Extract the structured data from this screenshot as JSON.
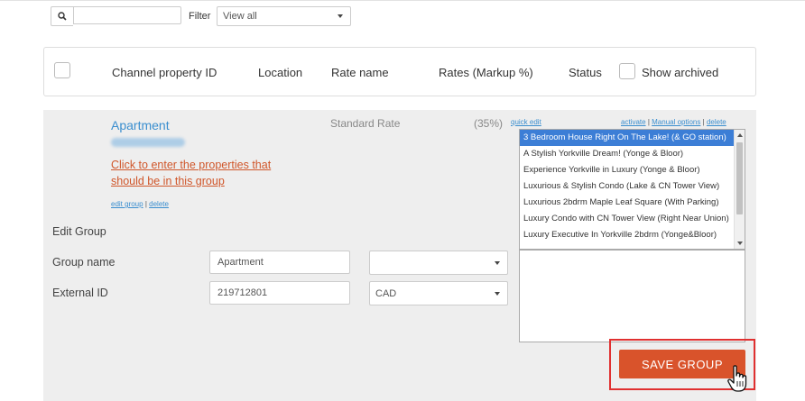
{
  "toolbar": {
    "search_value": "",
    "filter_label": "Filter",
    "filter_value": "View all"
  },
  "header": {
    "col_channel_property_id": "Channel property ID",
    "col_location": "Location",
    "col_rate_name": "Rate name",
    "col_rates_markup": "Rates (Markup %)",
    "col_status": "Status",
    "show_archived_label": "Show archived"
  },
  "group": {
    "title": "Apartment",
    "enter_properties_link": "Click to enter the properties that should be in this group",
    "edit_group_link": "edit group",
    "delete_link": "delete",
    "rate_name": "Standard Rate",
    "markup": "(35%)",
    "quick_edit_link": "quick edit",
    "activate_link": "activate",
    "manual_options_link": "Manual options",
    "delete_link_right": "delete",
    "separator": "|"
  },
  "edit_form": {
    "section_title": "Edit Group",
    "group_name_label": "Group name",
    "group_name_value": "Apartment",
    "external_id_label": "External ID",
    "external_id_value": "219712801",
    "select_top_value": "",
    "currency_value": "CAD"
  },
  "properties_list": [
    "3 Bedroom House Right On The Lake! (& GO station)",
    "A Stylish Yorkville Dream! (Yonge & Bloor)",
    "Experience Yorkville in Luxury (Yonge & Bloor)",
    "Luxurious & Stylish Condo (Lake & CN Tower View)",
    "Luxurious 2bdrm Maple Leaf Square (With Parking)",
    "Luxury Condo with CN Tower View (Right Near Union)",
    "Luxury Executive In Yorkville 2bdrm (Yonge&Bloor)"
  ],
  "save_button_label": "SAVE GROUP",
  "colors": {
    "accent_blue": "#3a8ecf",
    "link_orange": "#d0562a",
    "save_button": "#d9532b",
    "highlight_red": "#e03030",
    "list_selected": "#3c7ed6"
  },
  "icons": {
    "search": "search-icon",
    "dropdown": "chevron-down-icon",
    "cursor": "hand-pointer-icon"
  }
}
